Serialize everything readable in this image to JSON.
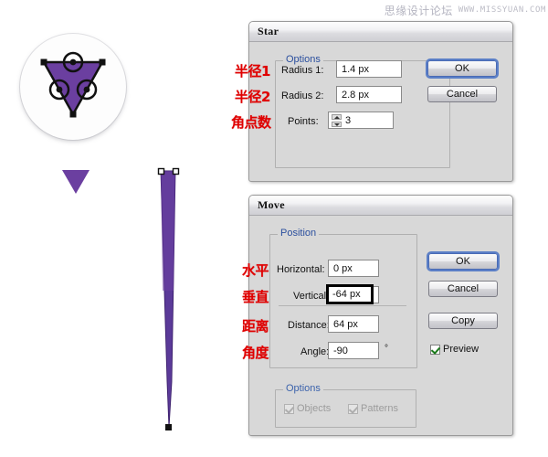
{
  "watermark": {
    "cn": "思缘设计论坛",
    "en": "WWW.MISSYUAN.COM"
  },
  "artwork": {
    "icon_card_name": "triangle-anchor-preview",
    "triangle_color": "#6b3fa0",
    "spike_color": "#5b3a99",
    "small_triangle_name": "purple-down-triangle",
    "spike_name": "tapered-purple-spike"
  },
  "star_dialog": {
    "title": "Star",
    "options_legend": "Options",
    "fields": [
      {
        "label": "Radius 1:",
        "value": "1.4 px",
        "annotation": "半径1"
      },
      {
        "label": "Radius 2:",
        "value": "2.8 px",
        "annotation": "半径2"
      },
      {
        "label": "Points:",
        "value": "3",
        "annotation": "角点数"
      }
    ],
    "buttons": [
      {
        "label": "OK",
        "default": true
      },
      {
        "label": "Cancel",
        "default": false
      }
    ]
  },
  "move_dialog": {
    "title": "Move",
    "position_legend": "Position",
    "options_legend": "Options",
    "fields": [
      {
        "label": "Horizontal:",
        "value": "0 px",
        "annotation": "水平"
      },
      {
        "label": "Vertical:",
        "value": "-64 px",
        "annotation": "垂直"
      },
      {
        "label": "Distance:",
        "value": "64 px",
        "annotation": "距离"
      },
      {
        "label": "Angle:",
        "value": "-90",
        "annotation": "角度",
        "unit": "°"
      }
    ],
    "buttons": [
      {
        "label": "OK",
        "default": true
      },
      {
        "label": "Cancel",
        "default": false
      },
      {
        "label": "Copy",
        "default": false
      }
    ],
    "preview": {
      "label": "Preview",
      "checked": true
    },
    "option_checkboxes": [
      {
        "label": "Objects",
        "checked": true,
        "disabled": true
      },
      {
        "label": "Patterns",
        "checked": true,
        "disabled": true
      }
    ]
  }
}
